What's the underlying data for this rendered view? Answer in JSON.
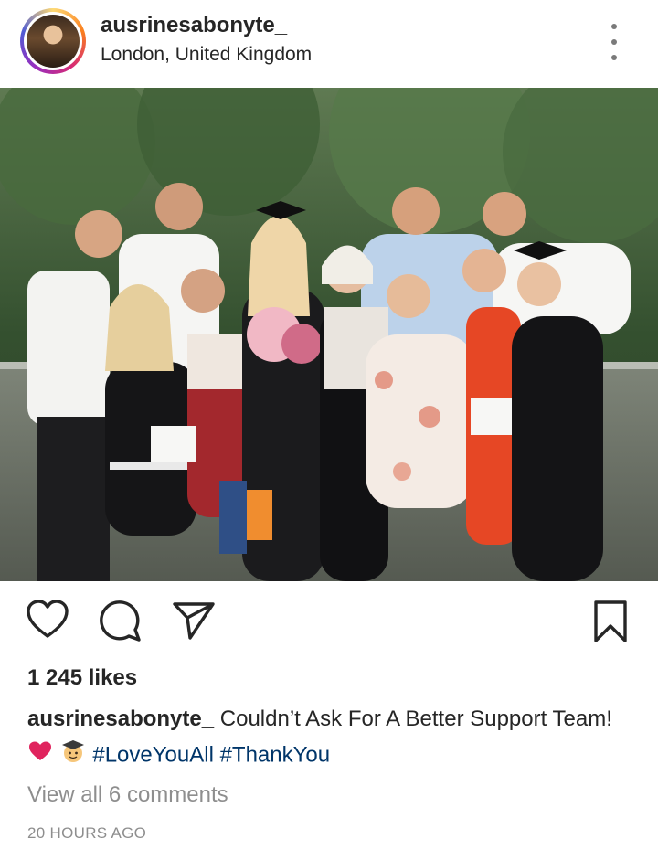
{
  "post": {
    "username": "ausrinesabonyte_",
    "location": "London, United Kingdom",
    "likes": "1 245 likes",
    "caption": {
      "username": "ausrinesabonyte_",
      "text": " Couldn’t Ask For A Better Support Team! ",
      "hashtags": [
        "#LoveYouAll",
        "#ThankYou"
      ]
    },
    "view_comments": "View all 6 comments",
    "timestamp": "20 HOURS AGO"
  },
  "icons": {
    "like": "heart-icon",
    "comment": "comment-bubble-icon",
    "share": "paper-plane-icon",
    "save": "bookmark-icon",
    "more": "more-vertical-icon",
    "caption_emojis": [
      "red-heart-icon",
      "graduate-emoji-icon"
    ]
  },
  "colors": {
    "text": "#262626",
    "muted": "#8e8e8e",
    "hashtag": "#003569",
    "ring_gradient": [
      "#feda75",
      "#fa7e1e",
      "#d62976",
      "#962fbf",
      "#4f5bd5"
    ]
  }
}
